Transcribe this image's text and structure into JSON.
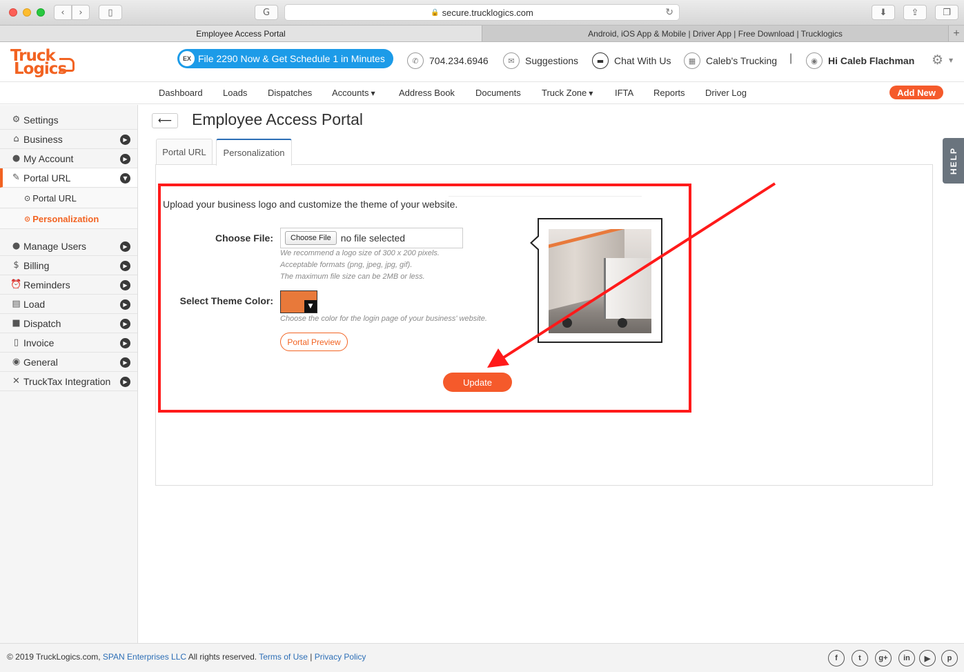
{
  "browser": {
    "url": "secure.trucklogics.com",
    "tabs": [
      {
        "label": "Employee Access Portal",
        "active": true
      },
      {
        "label": "Android, iOS App & Mobile | Driver App | Free Download | Trucklogics",
        "active": false
      }
    ]
  },
  "logo": {
    "line1": "Truck",
    "line2": "Logics"
  },
  "header": {
    "promo": "File 2290 Now & Get Schedule 1 in Minutes",
    "promo_icon": "EX",
    "phone": "704.234.6946",
    "suggestions": "Suggestions",
    "chat": "Chat With Us",
    "company": "Caleb's Trucking",
    "separator": "|",
    "greeting": "Hi Caleb Flachman"
  },
  "nav": {
    "items": [
      "Dashboard",
      "Loads",
      "Dispatches",
      "Accounts",
      "Address Book",
      "Documents",
      "Truck Zone",
      "IFTA",
      "Reports",
      "Driver Log"
    ],
    "add_new": "Add New"
  },
  "sidebar": {
    "items": [
      "Settings",
      "Business",
      "My Account",
      "Portal URL",
      "Manage Users",
      "Billing",
      "Reminders",
      "Load",
      "Dispatch",
      "Invoice",
      "General",
      "TruckTax Integration"
    ],
    "sub_items": [
      "Portal URL",
      "Personalization"
    ]
  },
  "page": {
    "title": "Employee Access Portal",
    "tabs": [
      "Portal URL",
      "Personalization"
    ],
    "intro": "Upload your business logo and customize the theme of your website.",
    "choose_file_label": "Choose File:",
    "choose_file_button": "Choose File",
    "file_status": "no file selected",
    "file_hints": [
      "We recommend a logo size of 300 x 200 pixels.",
      "Acceptable formats (png, jpeg, jpg, gif).",
      "The maximum file size can be 2MB or less."
    ],
    "theme_label": "Select Theme Color:",
    "theme_color": "#e8793a",
    "theme_hint": "Choose the color for the login page of your business' website.",
    "preview_button": "Portal Preview",
    "update_button": "Update",
    "help": "HELP"
  },
  "footer": {
    "copyright": "© 2019 TruckLogics.com, ",
    "company_link": "SPAN Enterprises LLC",
    "rights": " All rights reserved. ",
    "terms": "Terms of Use",
    "divider": " | ",
    "privacy": "Privacy Policy",
    "social": [
      "f",
      "t",
      "g+",
      "in",
      "▶",
      "p"
    ]
  },
  "colors": {
    "brand": "#f26322",
    "accent_blue": "#1c9be8",
    "annotation_red": "#ff1a1a"
  }
}
